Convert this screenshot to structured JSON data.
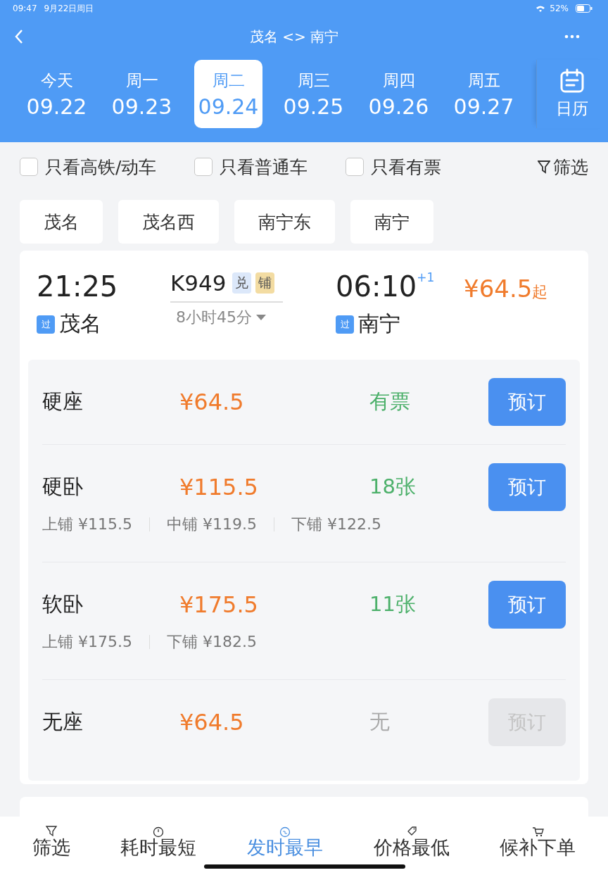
{
  "status_bar": {
    "time": "09:47",
    "date": "9月22日周日",
    "battery": "52%"
  },
  "header": {
    "title": "茂名 <> 南宁",
    "calendar_label": "日历",
    "tabs": [
      {
        "weekday": "今天",
        "date": "09.22",
        "selected": false
      },
      {
        "weekday": "周一",
        "date": "09.23",
        "selected": false
      },
      {
        "weekday": "周二",
        "date": "09.24",
        "selected": true
      },
      {
        "weekday": "周三",
        "date": "09.25",
        "selected": false
      },
      {
        "weekday": "周四",
        "date": "09.26",
        "selected": false
      },
      {
        "weekday": "周五",
        "date": "09.27",
        "selected": false
      }
    ]
  },
  "filters": [
    {
      "label": "只看高铁/动车",
      "checked": false
    },
    {
      "label": "只看普通车",
      "checked": false
    },
    {
      "label": "只看有票",
      "checked": false
    }
  ],
  "filter_button": "筛选",
  "stations": [
    "茂名",
    "茂名西",
    "南宁东",
    "南宁"
  ],
  "train": {
    "depart_time": "21:25",
    "number": "K949",
    "tags": [
      {
        "label": "兑",
        "color": "#dce8fa"
      },
      {
        "label": "铺",
        "color": "#f3dca2"
      }
    ],
    "duration": "8小时45分",
    "arrive_time": "06:10",
    "day_offset": "+1",
    "price": "¥64.5",
    "price_suffix": "起",
    "from": {
      "badge": "过",
      "name": "茂名"
    },
    "to": {
      "badge": "过",
      "name": "南宁"
    }
  },
  "seats": [
    {
      "name": "硬座",
      "price": "¥64.5",
      "availability": "有票",
      "button": "预订",
      "disabled": false
    },
    {
      "name": "硬卧",
      "price": "¥115.5",
      "availability": "18张",
      "button": "预订",
      "disabled": false,
      "berths": [
        "上铺 ¥115.5",
        "中铺 ¥119.5",
        "下铺 ¥122.5"
      ]
    },
    {
      "name": "软卧",
      "price": "¥175.5",
      "availability": "11张",
      "button": "预订",
      "disabled": false,
      "berths": [
        "上铺 ¥175.5",
        "下铺 ¥182.5"
      ]
    },
    {
      "name": "无座",
      "price": "¥64.5",
      "availability": "无",
      "button": "预订",
      "disabled": true
    }
  ],
  "bottom_tabs": [
    {
      "label": "筛选",
      "kind": "filter",
      "selected": false
    },
    {
      "label": "耗时最短",
      "kind": "timer",
      "selected": false
    },
    {
      "label": "发时最早",
      "kind": "clock",
      "selected": true
    },
    {
      "label": "价格最低",
      "kind": "tag",
      "selected": false
    },
    {
      "label": "候补下单",
      "kind": "cart",
      "selected": false
    }
  ]
}
